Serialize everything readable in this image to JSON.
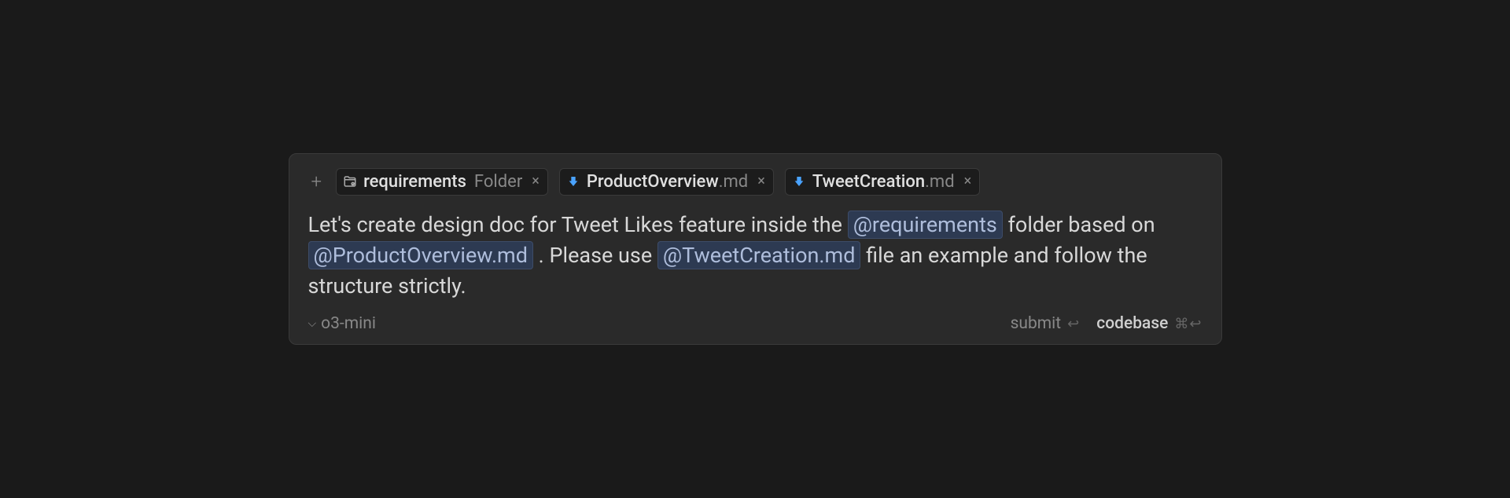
{
  "context": {
    "add_icon": "+",
    "chips": [
      {
        "icon": "folder",
        "name": "requirements",
        "ext": "",
        "meta": "Folder"
      },
      {
        "icon": "md",
        "name": "ProductOverview",
        "ext": ".md",
        "meta": ""
      },
      {
        "icon": "md",
        "name": "TweetCreation",
        "ext": ".md",
        "meta": ""
      }
    ]
  },
  "prompt": {
    "parts": [
      {
        "t": "text",
        "v": "Let's create design doc for Tweet Likes feature inside the "
      },
      {
        "t": "mention",
        "v": "@requirements"
      },
      {
        "t": "text",
        "v": " folder based on "
      },
      {
        "t": "mention",
        "v": "@ProductOverview.md"
      },
      {
        "t": "text",
        "v": " . Please use "
      },
      {
        "t": "mention",
        "v": "@TweetCreation.md"
      },
      {
        "t": "text",
        "v": " file an example and follow the structure strictly."
      }
    ]
  },
  "footer": {
    "model": "o3-mini",
    "submit_label": "submit",
    "submit_key": "↩",
    "codebase_label": "codebase",
    "codebase_key": "⌘↩"
  }
}
